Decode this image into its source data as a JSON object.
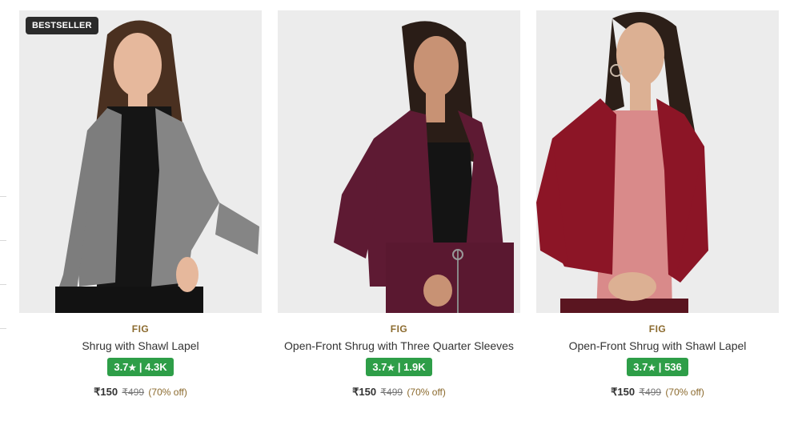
{
  "products": [
    {
      "badge": "BESTSELLER",
      "brand": "FIG",
      "name": "Shrug with Shawl Lapel",
      "rating": "3.7",
      "rating_count": "4.3K",
      "price": "₹150",
      "mrp": "₹499",
      "discount": "(70% off)",
      "colors": {
        "background": "#ececec",
        "garment": "#7d7d7d",
        "inner": "#151515",
        "skin": "#e6b89c",
        "hair": "#4a3020"
      }
    },
    {
      "brand": "FIG",
      "name": "Open-Front Shrug with Three Quarter Sleeves",
      "rating": "3.7",
      "rating_count": "1.9K",
      "price": "₹150",
      "mrp": "₹499",
      "discount": "(70% off)",
      "colors": {
        "background": "#ececec",
        "garment": "#5e1a33",
        "inner": "#141414",
        "skin": "#c89274",
        "hair": "#2a1d17"
      }
    },
    {
      "brand": "FIG",
      "name": "Open-Front Shrug with Shawl Lapel",
      "rating": "3.7",
      "rating_count": "536",
      "price": "₹150",
      "mrp": "₹499",
      "discount": "(70% off)",
      "colors": {
        "background": "#ececec",
        "garment": "#8c1526",
        "inner": "#d98a8a",
        "skin": "#dcb093",
        "hair": "#2c1f18"
      }
    }
  ],
  "star_icon": "star-icon",
  "rating_color": "#2e9e48",
  "brand_color": "#8b6a2e"
}
